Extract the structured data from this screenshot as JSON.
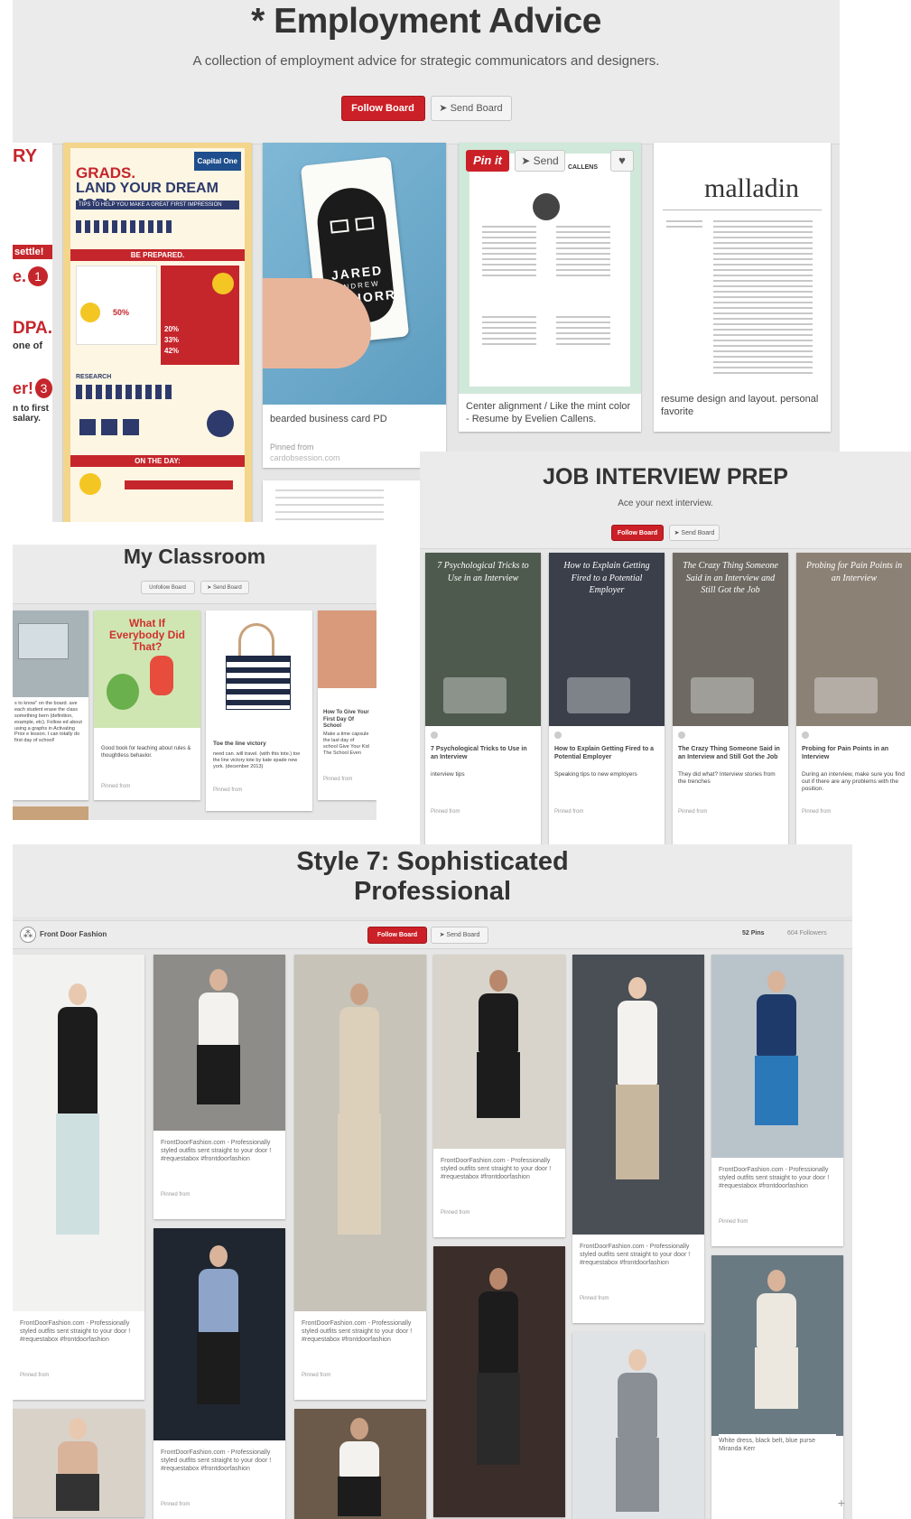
{
  "employment": {
    "title": "* Employment Advice",
    "description": "A collection of employment advice for strategic communicators and designers.",
    "follow_label": "Follow Board",
    "send_label": "Send Board",
    "pins": [
      {
        "caption": "",
        "infographic": {
          "brand": "Capital One",
          "headline1": "GRADS.",
          "headline2": "LAND YOUR DREAM JOB!",
          "banner": "TIPS TO HELP YOU MAKE A GREAT FIRST IMPRESSION",
          "sec1": "BE PREPARED.",
          "sec2": "RESEARCH",
          "sec3": "ON THE DAY:",
          "p1": "50%",
          "p2": "20%",
          "p3": "33%",
          "p4": "42%"
        }
      },
      {
        "caption": "bearded business card PD",
        "pinned_from_label": "Pinned from",
        "source": "cardobsession.com",
        "card_text": [
          "JARED",
          "ANDREW",
          "SCHORR"
        ]
      },
      {
        "caption": "Center alignment / Like the mint color - Resume by Evelien Callens.",
        "pinit_label": "Pin it",
        "send_label": "Send",
        "resume_header": "CALLENS"
      },
      {
        "caption": "resume design and layout. personal favorite",
        "resume_name": "malladin"
      }
    ],
    "left_fragment": [
      "RY",
      "settle!",
      "e.",
      "1",
      "DPA.",
      "one of",
      "er!",
      "3",
      "n to first",
      "salary."
    ]
  },
  "interview": {
    "title": "JOB INTERVIEW PREP",
    "description": "Ace your next interview.",
    "follow_label": "Follow Board",
    "send_label": "Send Board",
    "pins": [
      {
        "overlay": "7 Psychological Tricks to Use in an Interview",
        "caption": "7 Psychological Tricks to Use in an Interview",
        "detail": "interview tips",
        "img_color": "#4f5a4e"
      },
      {
        "overlay": "How to Explain Getting Fired to a Potential Employer",
        "caption": "How to Explain Getting Fired to a Potential Employer",
        "detail": "Speaking tips to new employers",
        "img_color": "#3a3f4a"
      },
      {
        "overlay": "The Crazy Thing Someone Said in an Interview and Still Got the Job",
        "caption": "The Crazy Thing Someone Said in an Interview and Still Got the Job",
        "detail": "They did what? Interview stories from the trenches",
        "img_color": "#6e6a63"
      },
      {
        "overlay": "Probing for Pain Points in an Interview",
        "caption": "Probing for Pain Points in an Interview",
        "detail": "During an interview, make sure you find out if there are any problems with the position.",
        "img_color": "#8c8175"
      }
    ],
    "pinned_from_label": "Pinned from"
  },
  "classroom": {
    "title": "My Classroom",
    "unfollow_label": "Unfollow Board",
    "send_label": "Send Board",
    "pins": [
      {
        "caption": "s to know\" on the board. ave each student erase the class something bern (definition, example, etc). Follow ed about using a graphs in Activating Prior e lesson. I can totally do first day of school!",
        "img_color": "#a8b3b8"
      },
      {
        "caption": "Good book for teaching about rules & thoughtless behavior.",
        "book_title": "What If Everybody Did That?",
        "pinned_from_label": "Pinned from"
      },
      {
        "caption": "Toe the line victory",
        "detail": "need can. will travel. (with this tote.) toe the line victory tote by kate spade new york. (december 2013)",
        "pinned_from_label": "Pinned from"
      },
      {
        "caption": "How To Give Your First Day Of School",
        "detail": "Make a time capsule the last day of school Give Your Kid The School Even",
        "pinned_from_label": "Pinned from"
      }
    ]
  },
  "style": {
    "title_line1": "Style 7: Sophisticated",
    "title_line2": "Professional",
    "board_owner": "Front Door Fashion",
    "follow_label": "Follow Board",
    "send_label": "Send Board",
    "pins_count": "52 Pins",
    "followers_count": "604 Followers",
    "caption": "FrontDoorFashion.com - Professionally styled outfits sent straight to your door ! #requestabox #frontdoorfashion",
    "pinned_from_label": "Pinned from",
    "last_caption": "White dress, black belt, blue purse Miranda Kerr"
  }
}
